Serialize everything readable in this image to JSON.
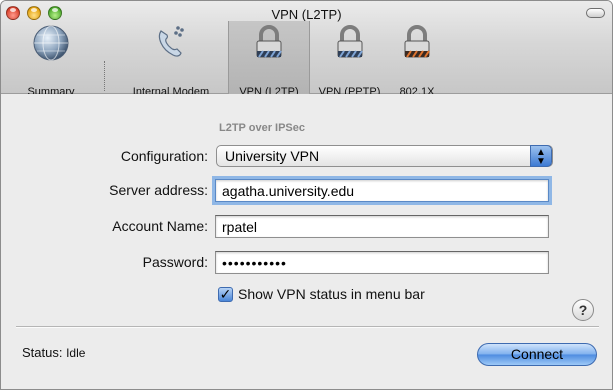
{
  "window": {
    "title": "VPN (L2TP)"
  },
  "toolbar": {
    "items": [
      {
        "label": "Summary",
        "icon": "globe-icon"
      },
      {
        "label": "Internal Modem",
        "icon": "phone-icon"
      },
      {
        "label": "VPN (L2TP)",
        "icon": "lock-icon"
      },
      {
        "label": "VPN (PPTP)",
        "icon": "lock-icon"
      },
      {
        "label": "802.1X",
        "icon": "lock-icon"
      }
    ],
    "selected": "VPN (L2TP)"
  },
  "form": {
    "section_label": "L2TP over IPSec",
    "configuration": {
      "label": "Configuration:",
      "value": "University VPN"
    },
    "server_address": {
      "label": "Server address:",
      "value": "agatha.university.edu"
    },
    "account_name": {
      "label": "Account Name:",
      "value": "rpatel"
    },
    "password": {
      "label": "Password:",
      "value": "•••••••••••"
    },
    "show_status": {
      "label": "Show VPN status in menu bar",
      "checked": true
    }
  },
  "help": {
    "glyph": "?"
  },
  "status": {
    "label": "Status:",
    "value": "Idle"
  },
  "connect_button": {
    "label": "Connect"
  },
  "colors": {
    "accent": "#4d8be0",
    "focus_ring": "#8fb7e6"
  }
}
